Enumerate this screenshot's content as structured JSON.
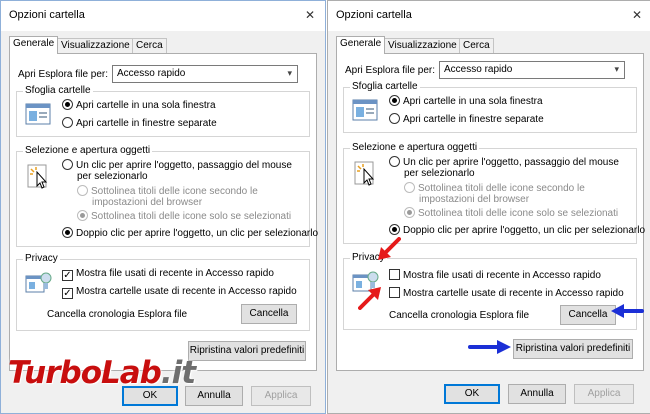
{
  "dialog": {
    "title": "Opzioni cartella",
    "close_label": "✕",
    "tabs": [
      "Generale",
      "Visualizzazione",
      "Cerca"
    ],
    "open_label": "Apri Esplora file per:",
    "open_value": "Accesso rapido",
    "browse_legend": "Sfoglia cartelle",
    "browse_opt1": "Apri cartelle in una sola finestra",
    "browse_opt2": "Apri cartelle in finestre separate",
    "click_legend": "Selezione e apertura oggetti",
    "single_click_line1": "Un clic per aprire l'oggetto, passaggio del mouse",
    "single_click_line2": "per selezionarlo",
    "underline_opt1_line1": "Sottolinea titoli delle icone secondo le",
    "underline_opt1_line2": "impostazioni del browser",
    "underline_opt2": "Sottolinea titoli delle icone solo se selezionati",
    "double_click": "Doppio clic per aprire l'oggetto, un clic per selezionarlo",
    "privacy_legend": "Privacy",
    "privacy_files": "Mostra file usati di recente in Accesso rapido",
    "privacy_folders": "Mostra cartelle usate di recente in Accesso rapido",
    "clear_history": "Cancella cronologia Esplora file",
    "clear_button": "Cancella",
    "restore_button": "Ripristina valori predefiniti",
    "ok_button": "OK",
    "cancel_button": "Annulla",
    "apply_button": "Applica"
  },
  "left": {
    "files_checked": true,
    "folders_checked": true
  },
  "right": {
    "files_checked": false,
    "folders_checked": false
  },
  "watermark": {
    "part1": "TurboLab",
    "part2": ".it"
  },
  "colors": {
    "highlight_red": "#e51a1a",
    "highlight_blue": "#1b2fd6",
    "accent": "#0078d7"
  }
}
